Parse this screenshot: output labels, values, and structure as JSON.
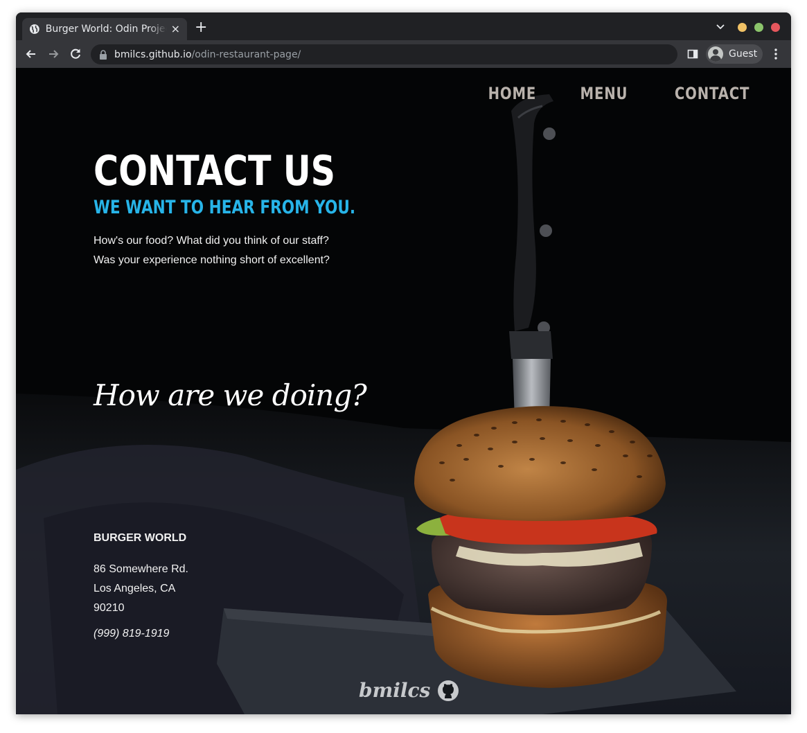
{
  "browser": {
    "tab_title": "Burger World: Odin Project",
    "tab_close": "×",
    "new_tab": "+",
    "url_host": "bmilcs.github.io",
    "url_path": "/odin-restaurant-page/",
    "profile_name": "Guest",
    "icons": [
      "globe-icon",
      "tab-search-icon",
      "back-icon",
      "forward-icon",
      "reload-icon",
      "lock-icon",
      "side-panel-icon",
      "avatar",
      "more-menu-icon"
    ],
    "colors": {
      "minimize": "#f1c266",
      "maximize": "#8bc46b",
      "close": "#e6575d"
    }
  },
  "site": {
    "nav": {
      "home": "HOME",
      "menu": "MENU",
      "contact": "CONTACT"
    },
    "heading": "CONTACT US",
    "subheading": "WE WANT TO HEAR FROM YOU.",
    "intro": {
      "line1": "How's our food? What did you think of our staff?",
      "line2": "Was your experience nothing short of excellent?"
    },
    "script_heading": "How are we doing?",
    "address": {
      "name": "BURGER WORLD",
      "street": "86 Somewhere Rd.",
      "city": "Los Angeles, CA",
      "zip": "90210",
      "phone": "(999) 819-1919"
    },
    "footer": {
      "signature": "bmilcs",
      "icon": "github-icon"
    },
    "colors": {
      "accent": "#27b4e8",
      "nav": "#b9b2ac",
      "text": "#ffffff"
    }
  }
}
